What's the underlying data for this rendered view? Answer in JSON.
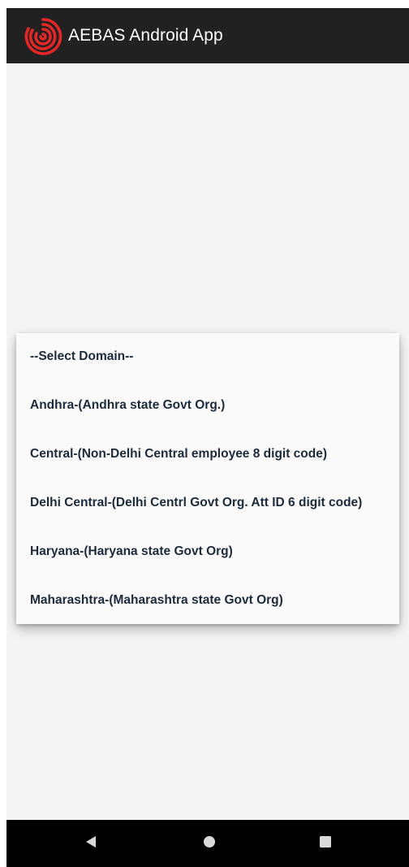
{
  "app_bar": {
    "title": "AEBAS Android App",
    "logo_icon": "fingerprint-logo-icon",
    "logo_color": "#e32626"
  },
  "domain_dropdown": {
    "items": [
      {
        "label": "--Select Domain--"
      },
      {
        "label": "Andhra-(Andhra state Govt Org.)"
      },
      {
        "label": "Central-(Non-Delhi Central employee 8 digit  code)"
      },
      {
        "label": "Delhi Central-(Delhi Centrl Govt Org. Att ID 6 digit code)"
      },
      {
        "label": "Haryana-(Haryana state Govt Org)"
      },
      {
        "label": "Maharashtra-(Maharashtra state Govt Org)"
      }
    ]
  },
  "nav_bar": {
    "back_icon": "back-triangle-icon",
    "home_icon": "home-circle-icon",
    "recents_icon": "recents-square-icon"
  }
}
